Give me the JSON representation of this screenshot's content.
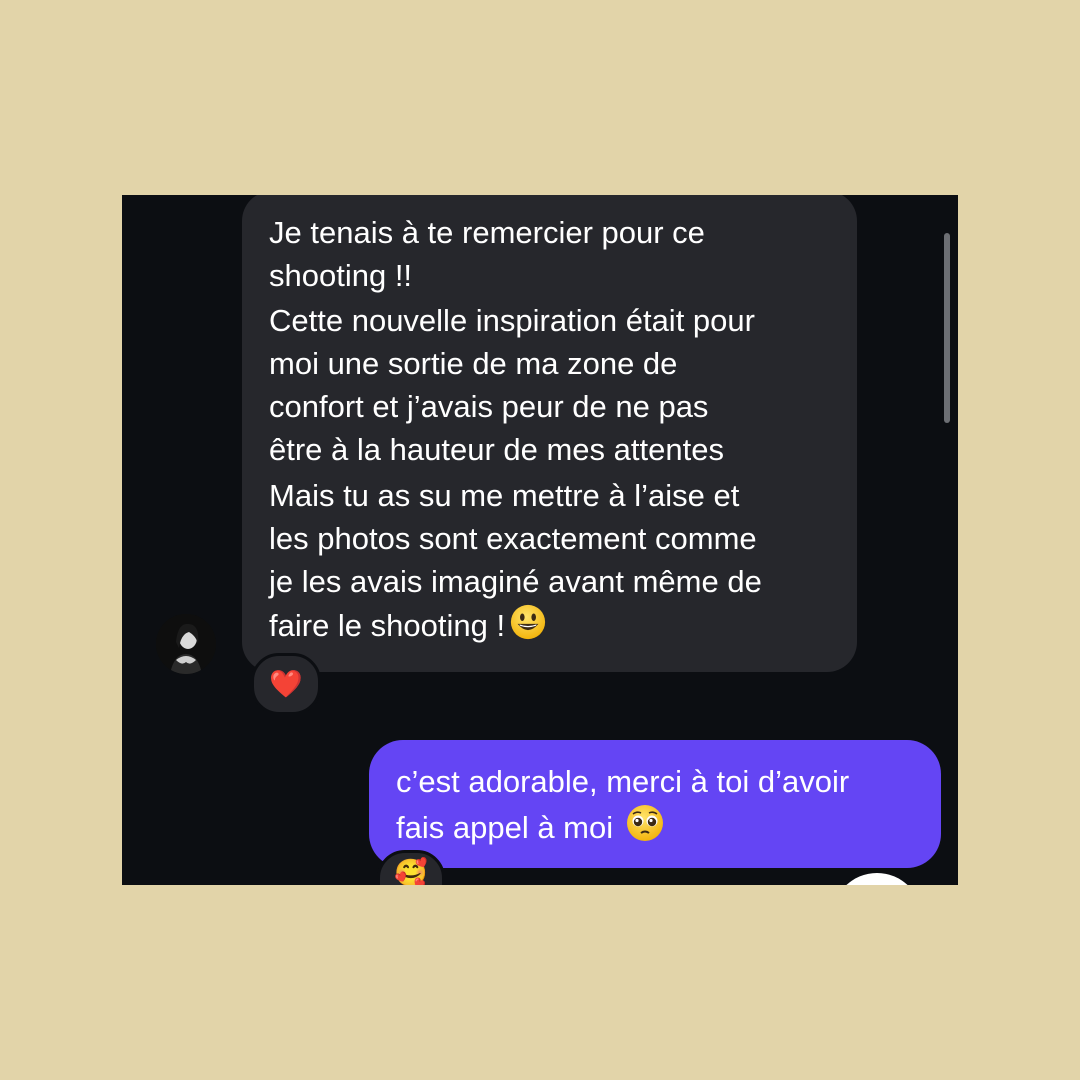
{
  "colors": {
    "background": "#e2d4a9",
    "screen": "#0c0e12",
    "incoming_bubble": "#26272c",
    "outgoing_bubble": "#6445f4",
    "text": "#ffffff"
  },
  "incoming_message": {
    "paragraphs": [
      "Je tenais à te remercier pour ce\nshooting !!",
      "Cette nouvelle inspiration était pour\nmoi une sortie de ma zone de\nconfort et j’avais peur de ne pas\nêtre à la hauteur de mes attentes",
      "Mais tu as su me mettre à l’aise et\nles photos sont exactement comme\nje les avais imaginé avant même de\nfaire le shooting !"
    ],
    "trailing_emoji": "smiling-face-icon",
    "reaction": "❤️"
  },
  "outgoing_message": {
    "text": "c’est adorable, merci à toi d’avoir\nfais appel à moi",
    "trailing_emoji": "pleading-face-icon",
    "reaction": "🥰"
  }
}
